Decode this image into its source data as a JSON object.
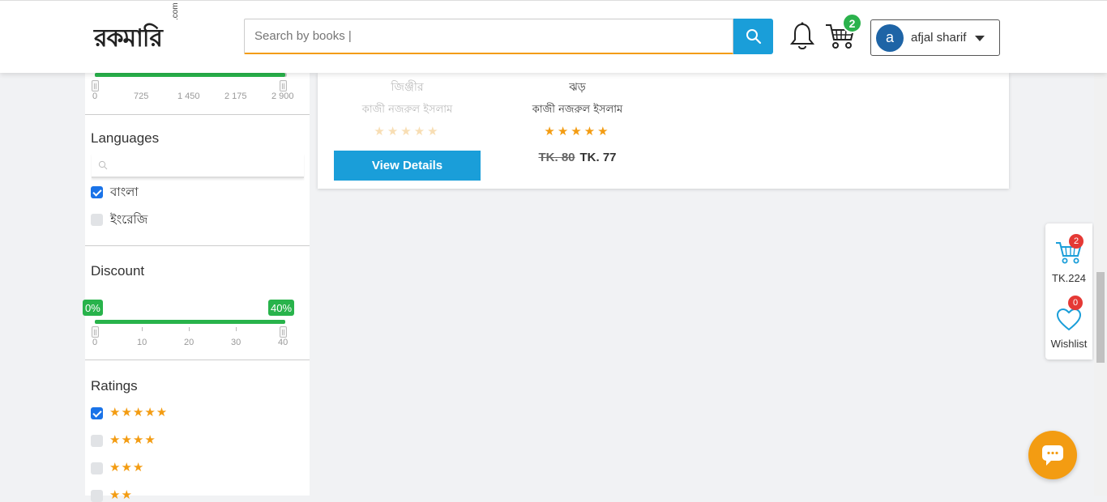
{
  "header": {
    "logo_main": "রকমারি",
    "logo_suffix": ".com",
    "search_placeholder": "Search by books |",
    "cart_count": "2",
    "user_initial": "a",
    "user_name": "afjal sharif"
  },
  "sidebar": {
    "price_ticks": [
      "0",
      "725",
      "1 450",
      "2 175",
      "2 900"
    ],
    "languages": {
      "title": "Languages",
      "options": [
        {
          "label": "বাংলা",
          "checked": true
        },
        {
          "label": "ইংরেজি",
          "checked": false
        }
      ]
    },
    "discount": {
      "title": "Discount",
      "min_label": "0%",
      "max_label": "40%",
      "ticks": [
        "0",
        "10",
        "20",
        "30",
        "40"
      ]
    },
    "ratings": {
      "title": "Ratings",
      "options": [
        {
          "stars": "★★★★★",
          "checked": true
        },
        {
          "stars": "★★★★",
          "checked": false
        },
        {
          "stars": "★★★",
          "checked": false
        },
        {
          "stars": "★★",
          "checked": false
        }
      ]
    }
  },
  "products": [
    {
      "title": "জিঞ্জীর",
      "author": "কাজী নজরুল ইসলাম",
      "stars": "★★★★★",
      "button": "View  Details"
    },
    {
      "title": "ঝড়",
      "author": "কাজী নজরুল ইসলাম",
      "stars": "★★★★★",
      "old_price": "TK. 80",
      "new_price": "TK. 77"
    }
  ],
  "float_widget": {
    "cart_badge": "2",
    "cart_total": "TK.224",
    "wishlist_badge": "0",
    "wishlist_label": "Wishlist"
  },
  "colors": {
    "primary": "#1a9ed9",
    "accent": "#f39c12",
    "green": "#28b34b",
    "badge_red": "#e53935"
  }
}
